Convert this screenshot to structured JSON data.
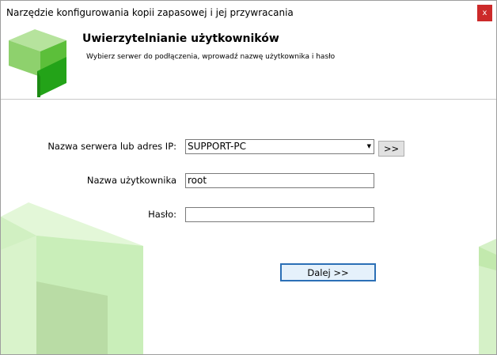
{
  "window": {
    "title": "Narzędzie konfigurowania kopii zapasowej i jej przywracania",
    "close_glyph": "x"
  },
  "header": {
    "title": "Uwierzytelnianie użytkowników",
    "subtitle": "Wybierz serwer do podłączenia, wprowadź nazwę użytkownika i hasło",
    "logo_icon": "green-cube-logo-icon"
  },
  "form": {
    "server": {
      "label": "Nazwa serwera lub adres IP:",
      "value": "SUPPORT-PC",
      "dropdown_glyph": "▼",
      "browse_label": ">>"
    },
    "username": {
      "label": "Nazwa użytkownika",
      "value": "root"
    },
    "password": {
      "label": "Hasło:",
      "value": ""
    },
    "next_label": "Dalej >>"
  },
  "colors": {
    "close_button": "#cc2a2a",
    "logo_green_light": "#8ed16d",
    "logo_green_dark": "#23a318",
    "background_art_green": "#c9eeb9",
    "next_button_border": "#2b6fb6"
  }
}
